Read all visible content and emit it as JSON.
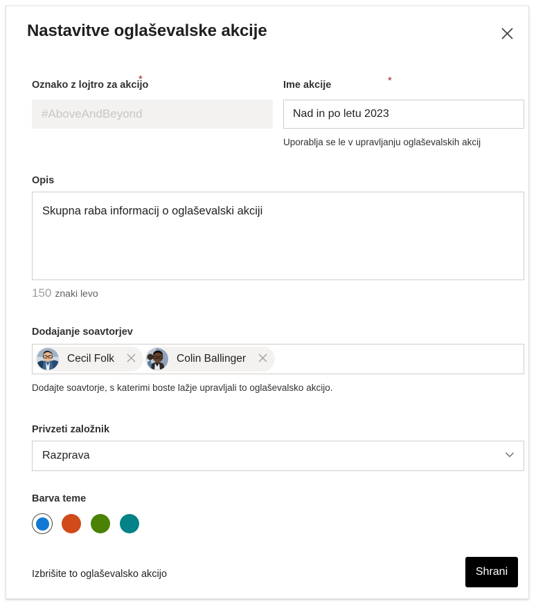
{
  "dialog": {
    "title": "Nastavitve oglaševalske akcije",
    "close_label": "Zapri"
  },
  "fields": {
    "hashtag": {
      "label": "Oznako z lojtro za akcijo",
      "required_marker": "*",
      "placeholder": "#AboveAndBeyond",
      "value": ""
    },
    "name": {
      "label": "Ime akcije",
      "required_marker": "*",
      "value": "Nad in po letu 2023",
      "helper": "Uporablja se le v upravljanju oglaševalskih akcij"
    },
    "description": {
      "label": "Opis",
      "value": "Skupna raba informacij o oglaševalski akciji",
      "chars_left": "150",
      "chars_left_label": "znaki levo"
    },
    "coauthors": {
      "label": "Dodajanje soavtorjev",
      "helper": "Dodajte soavtorje, s katerimi boste lažje upravljali to oglaševalsko akcijo.",
      "people": [
        {
          "name": "Cecil  Folk",
          "remove_label": "Odstrani"
        },
        {
          "name": "Colin Ballinger",
          "remove_label": "Odstrani"
        }
      ]
    },
    "publisher": {
      "label": "Privzeti založnik",
      "value": "Razprava",
      "chevron": "chevron-down-icon"
    },
    "theme": {
      "label": "Barva teme",
      "selected_index": 0,
      "swatches": [
        {
          "name": "blue",
          "color": "#1278d4"
        },
        {
          "name": "orange",
          "color": "#d04a1b"
        },
        {
          "name": "green",
          "color": "#498205"
        },
        {
          "name": "teal",
          "color": "#038287"
        }
      ]
    }
  },
  "footer": {
    "delete_link": "Izbrišite to oglaševalsko akcijo",
    "save_label": "Shrani"
  }
}
